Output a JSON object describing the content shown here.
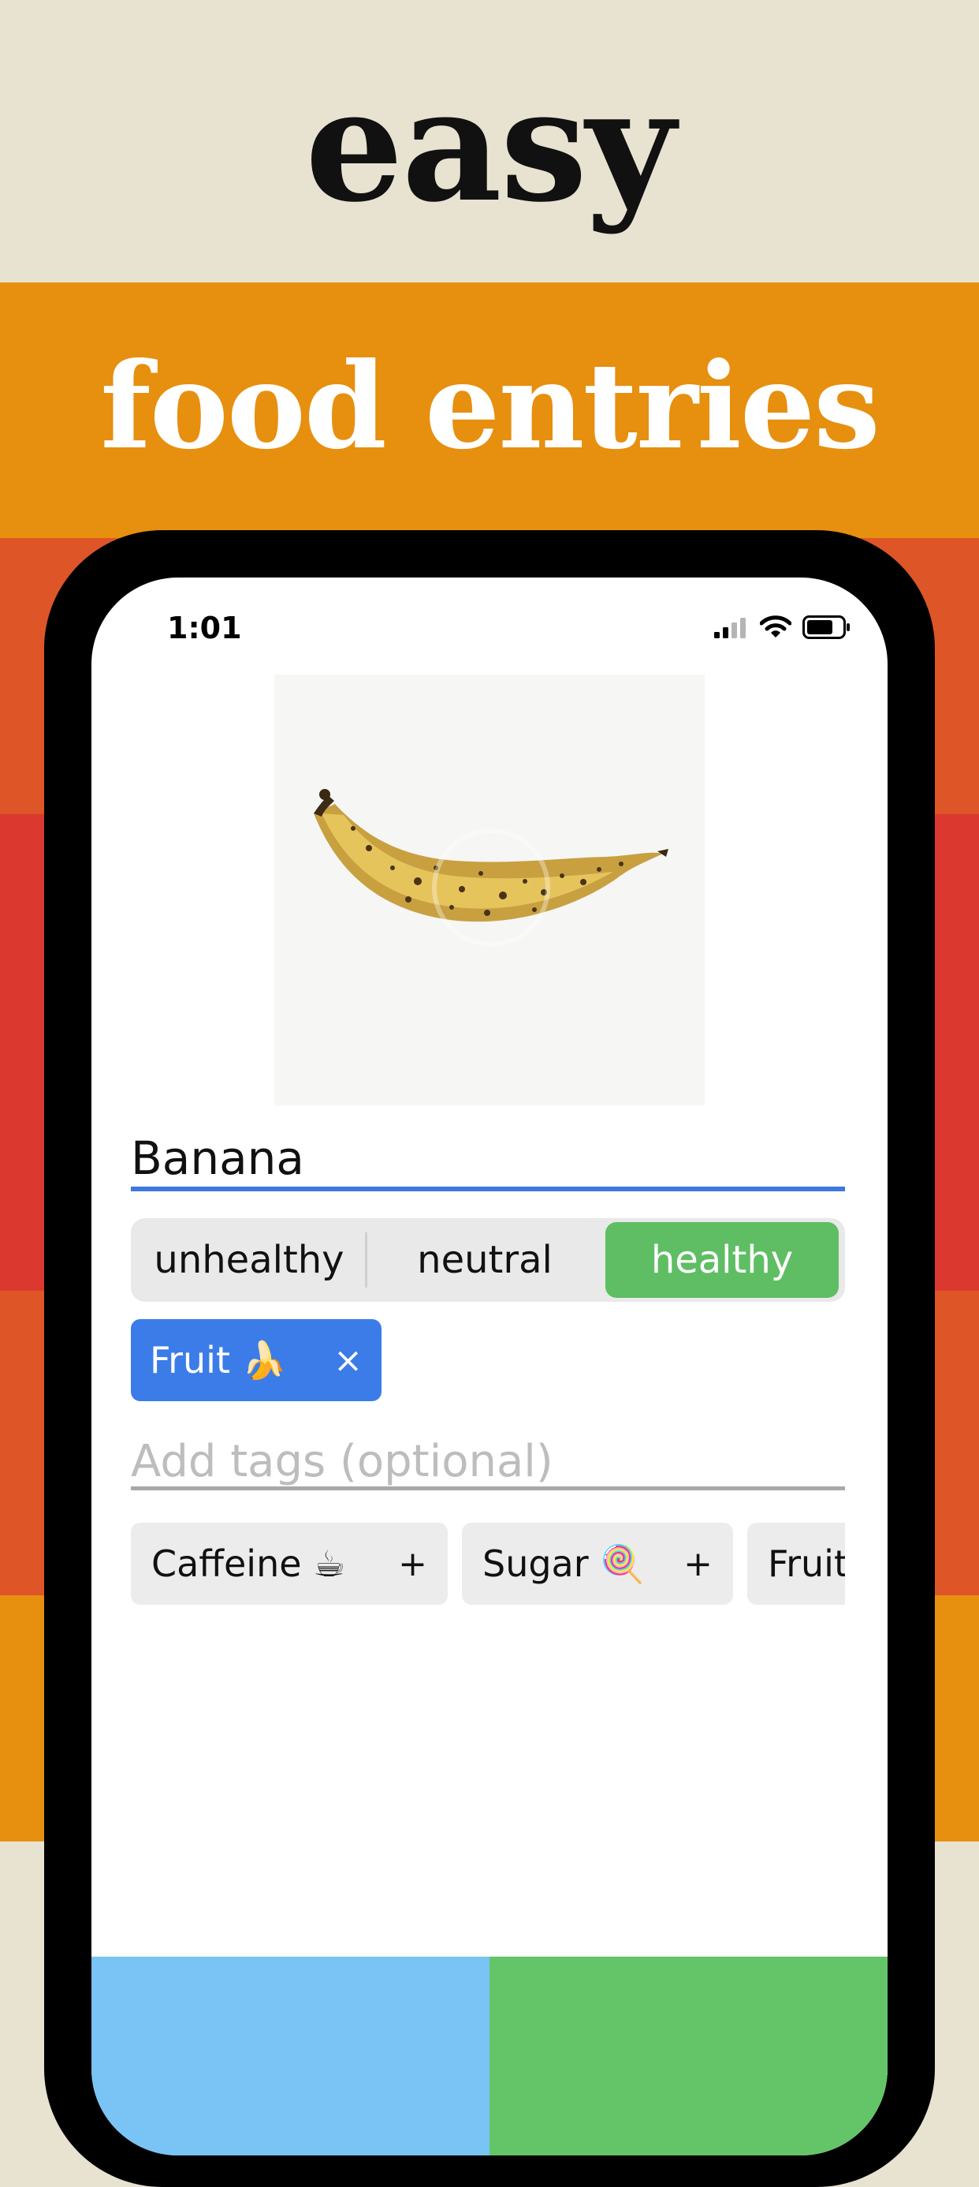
{
  "headline": {
    "line1": "easy",
    "line2": "food entries"
  },
  "status_bar": {
    "time": "1:01"
  },
  "entry": {
    "food_name": "Banana",
    "rating": {
      "options": [
        "unhealthy",
        "neutral",
        "healthy"
      ],
      "selected": "healthy"
    },
    "selected_tags": [
      {
        "label": "Fruit 🍌",
        "remove_symbol": "×"
      }
    ],
    "tags_input": {
      "placeholder": "Add tags (optional)"
    },
    "suggested_tags": [
      {
        "label": "Caffeine ☕",
        "add_symbol": "+"
      },
      {
        "label": "Sugar 🍭",
        "add_symbol": "+"
      },
      {
        "label": "Fruit"
      }
    ]
  },
  "colors": {
    "accent_blue": "#3b7ce8",
    "healthy_green": "#5fbe63",
    "orange": "#e78f0f",
    "red": "#db3930",
    "beige": "#e8e2d1"
  },
  "icons": [
    "cellular-signal-icon",
    "wifi-icon",
    "battery-icon",
    "banana-photo"
  ]
}
